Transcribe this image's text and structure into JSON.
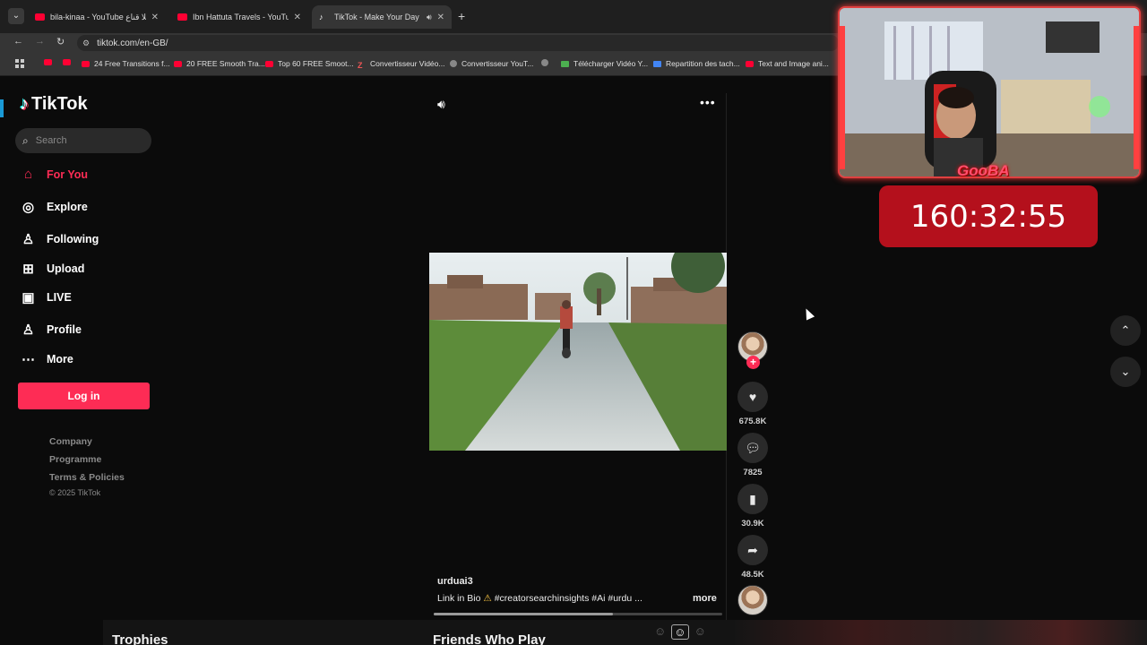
{
  "browser": {
    "tabs": [
      {
        "title": "bila-kinaa - YouTube بلا قناع",
        "icon": "youtube-icon",
        "active": false
      },
      {
        "title": "Ibn Hattuta Travels - YouTube",
        "icon": "youtube-icon",
        "active": false
      },
      {
        "title": "TikTok - Make Your Day",
        "icon": "tiktok-icon",
        "active": true
      }
    ],
    "new_tab": "+",
    "url": "tiktok.com/en-GB/",
    "bookmarks": [
      {
        "label": "24 Free Transitions f...",
        "icon": "youtube-icon"
      },
      {
        "label": "20 FREE Smooth Tra...",
        "icon": "youtube-icon"
      },
      {
        "label": "Top 60 FREE Smoot...",
        "icon": "youtube-icon"
      },
      {
        "label": "Convertisseur Vidéo...",
        "icon": "z-icon"
      },
      {
        "label": "Convertisseur YouT...",
        "icon": "convert-icon"
      },
      {
        "label": "Télécharger Vidéo Y...",
        "icon": "download-icon"
      },
      {
        "label": "Repartition des tach...",
        "icon": "docs-icon"
      },
      {
        "label": "Text and Image ani...",
        "icon": "youtube-icon"
      }
    ]
  },
  "sidebar": {
    "brand": "TikTok",
    "search_placeholder": "Search",
    "items": [
      {
        "label": "For You",
        "icon": "home-icon"
      },
      {
        "label": "Explore",
        "icon": "compass-icon"
      },
      {
        "label": "Following",
        "icon": "following-icon"
      },
      {
        "label": "Upload",
        "icon": "upload-icon"
      },
      {
        "label": "LIVE",
        "icon": "live-icon"
      },
      {
        "label": "Profile",
        "icon": "profile-icon"
      },
      {
        "label": "More",
        "icon": "more-icon"
      }
    ],
    "login_label": "Log in",
    "footer_links": [
      "Company",
      "Programme",
      "Terms & Policies"
    ],
    "copyright": "© 2025 TikTok"
  },
  "video": {
    "author": "urduai3",
    "caption_prefix": "Link in Bio",
    "caption_tags": "#creatorsearchinsights  #Ai  #urdu ...",
    "more_label": "more",
    "progress": 0.62,
    "likes": "675.8K",
    "comments": "7825",
    "saves": "30.9K",
    "shares": "48.5K"
  },
  "overlay": {
    "streamer_name": "GooBA",
    "timer": "160:32:55",
    "panel_left": "Trophies",
    "panel_center": "Friends Who Play"
  }
}
